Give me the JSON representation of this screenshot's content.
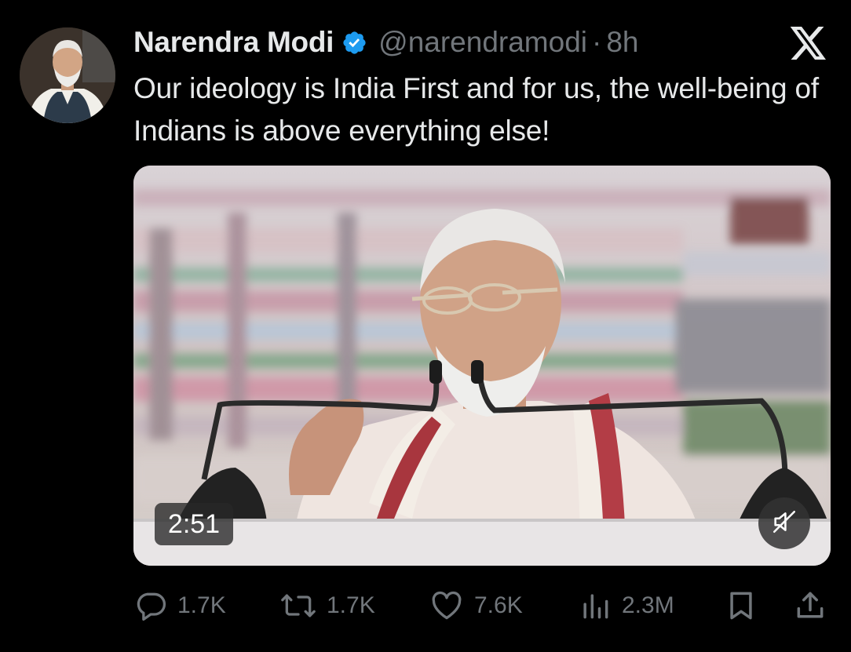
{
  "tweet": {
    "author_name": "Narendra Modi",
    "handle": "@narendramodi",
    "separator": "·",
    "time": "8h",
    "verified": true,
    "text": "Our ideology is India First and for us, the well-being of Indians is above everything else!",
    "media": {
      "type": "video",
      "duration": "2:51",
      "muted": true
    },
    "stats": {
      "replies": "1.7K",
      "reposts": "1.7K",
      "likes": "7.6K",
      "views": "2.3M"
    }
  },
  "icons": {
    "close": "x-logo-icon",
    "verified": "verified-badge-icon",
    "reply": "reply-icon",
    "repost": "repost-icon",
    "like": "heart-icon",
    "views": "views-icon",
    "bookmark": "bookmark-icon",
    "share": "share-icon",
    "mute": "muted-speaker-icon"
  },
  "colors": {
    "background": "#000000",
    "text": "#e7e9ea",
    "secondary": "#71767b",
    "verified": "#1d9bf0"
  }
}
